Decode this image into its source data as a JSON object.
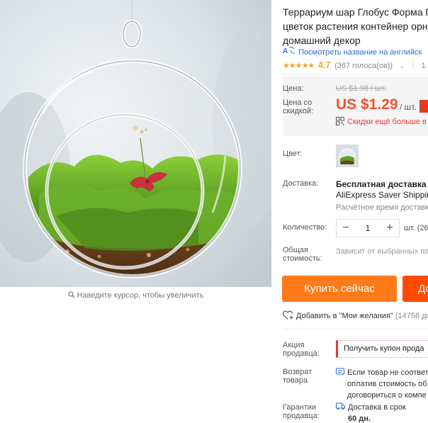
{
  "image": {
    "zoom_hint": "Наведите курсор, чтобы увеличить",
    "zoom_icon": "magnifier-icon"
  },
  "product": {
    "title_lines": [
      "Террариум шар Глобус Форма П",
      "цветок растения контейнер орн",
      "домашний декор"
    ],
    "translate_link": "Посмотреть название на английск",
    "translate_icon": "translate-icon",
    "rating": {
      "stars": "★★★★★",
      "value": "4.7",
      "votes": "(367 голоса(ов))",
      "orders": "1"
    }
  },
  "price": {
    "label": "Цена:",
    "old": "US $1.98 / шт.",
    "discount_label": "Цена со скидкой:",
    "new": "US $1.29",
    "unit": "/ шт.",
    "discount_link": "Скидки ещё больше в",
    "accent_color": "#f5512d"
  },
  "options": {
    "color_label": "Цвет:",
    "shipping_label": "Доставка:",
    "shipping_title": "Бесплатная доставка в",
    "shipping_method": "AliExpress Saver Shippin",
    "shipping_estimate": "Расчётное время доставк",
    "quantity_label": "Количество:",
    "quantity_value": "1",
    "quantity_minus": "−",
    "quantity_plus": "+",
    "quantity_unit": "шт. (26",
    "total_label": "Общая стоимость:",
    "total_value": "Зависит от выбранных пара"
  },
  "actions": {
    "buy_now": "Купить сейчас",
    "add_to_cart": "До",
    "wishlist": "Добавить в \"Мои желания\"",
    "wishlist_count": "(14758 до",
    "buy_color": "#ff7b1a",
    "cart_color": "#ff4a00"
  },
  "seller": {
    "promo_label": "Акция продавца:",
    "coupon": "Получить купон прода",
    "return_label": "Возврат товара",
    "return_lines": [
      "Если товар не соответ",
      "оплатив стоимость об",
      "договориться о компе"
    ],
    "guarantee_label": "Гарантии продавца:",
    "guarantee_lines": [
      "Доставка в срок",
      "60 дн."
    ]
  }
}
